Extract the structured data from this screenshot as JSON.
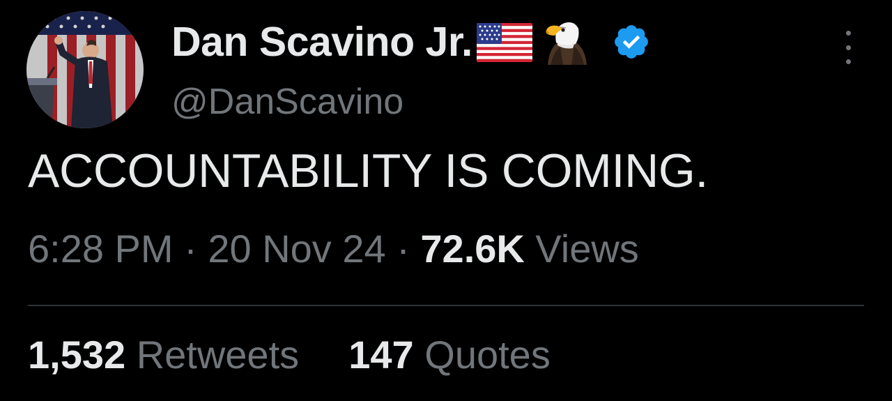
{
  "author": {
    "display_name": "Dan Scavino Jr.",
    "handle": "@DanScavino",
    "name_emojis": [
      "flag-us-icon",
      "eagle-icon"
    ],
    "verified": true,
    "verified_color": "#1d9bf0"
  },
  "tweet": {
    "text": "ACCOUNTABILITY IS COMING.",
    "time": "6:28 PM",
    "separator": "·",
    "date": "20 Nov 24",
    "views_count": "72.6K",
    "views_label": "Views"
  },
  "stats": {
    "retweets_count": "1,532",
    "retweets_label": "Retweets",
    "quotes_count": "147",
    "quotes_label": "Quotes"
  },
  "colors": {
    "background": "#000000",
    "primary_text": "#e7e9ea",
    "secondary_text": "#71767b",
    "divider": "#2f3336"
  },
  "icons": {
    "more": "more-vertical-icon",
    "verified": "verified-badge-icon"
  }
}
